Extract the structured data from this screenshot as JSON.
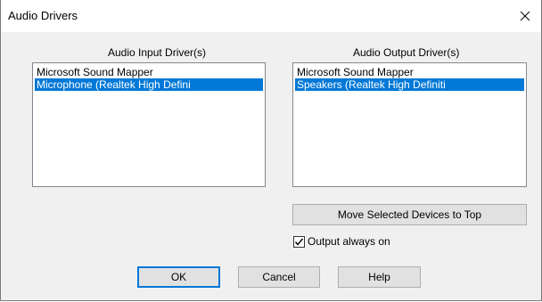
{
  "window": {
    "title": "Audio Drivers",
    "close_icon": "close-icon"
  },
  "input_group": {
    "label": "Audio Input Driver(s)",
    "items": [
      {
        "label": "Microsoft Sound Mapper",
        "selected": false
      },
      {
        "label": "Microphone (Realtek High Defini",
        "selected": true
      }
    ]
  },
  "output_group": {
    "label": "Audio Output Driver(s)",
    "items": [
      {
        "label": "Microsoft Sound Mapper",
        "selected": false
      },
      {
        "label": "Speakers (Realtek High Definiti",
        "selected": true
      }
    ]
  },
  "move_button": {
    "label": "Move Selected Devices to Top"
  },
  "output_always_on": {
    "label": "Output always on",
    "checked": true
  },
  "buttons": {
    "ok": "OK",
    "cancel": "Cancel",
    "help": "Help"
  },
  "colors": {
    "selection": "#0078d7",
    "dialog_bg": "#f0f0f0",
    "button_bg": "#e1e1e1",
    "default_button_border": "#0078d7"
  }
}
